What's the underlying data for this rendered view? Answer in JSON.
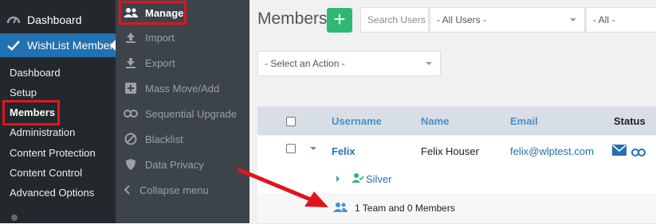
{
  "wp_menu": {
    "dashboard_label": "Dashboard",
    "plugin_label": "WishList Member",
    "submenu": [
      "Dashboard",
      "Setup",
      "Members",
      "Administration",
      "Content Protection",
      "Content Control",
      "Advanced Options"
    ]
  },
  "plugin_menu": {
    "items": [
      "Manage",
      "Import",
      "Export",
      "Mass Move/Add",
      "Sequential Upgrade",
      "Blacklist",
      "Data Privacy",
      "Collapse menu"
    ]
  },
  "main": {
    "title": "Members",
    "search_placeholder": "Search Users",
    "filter_users": "- All Users -",
    "filter_all": "- All -",
    "action_select": "- Select an Action -"
  },
  "table": {
    "columns": [
      "Username",
      "Name",
      "Email",
      "Status"
    ],
    "row": {
      "username": "Felix",
      "name": "Felix Houser",
      "email": "felix@wlptest.com",
      "level": "Silver",
      "team": "1 Team and 0 Members"
    }
  },
  "colors": {
    "highlight": "#e0151c",
    "accent": "#2eb872",
    "admin_blue": "#2271b1"
  }
}
